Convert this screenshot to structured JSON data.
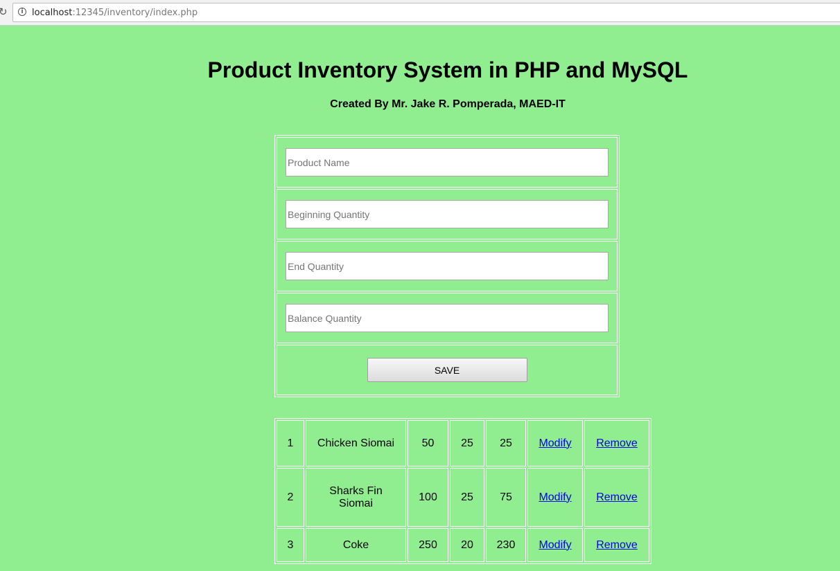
{
  "browser": {
    "url_host": "localhost",
    "url_path": ":12345/inventory/index.php"
  },
  "page": {
    "title": "Product Inventory System in PHP and MySQL",
    "subtitle": "Created By Mr. Jake R. Pomperada, MAED-IT"
  },
  "form": {
    "product_name_placeholder": "Product Name",
    "beginning_quantity_placeholder": "Beginning Quantity",
    "end_quantity_placeholder": "End Quantity",
    "balance_quantity_placeholder": "Balance Quantity",
    "save_label": "SAVE"
  },
  "products": [
    {
      "id": "1",
      "name": "Chicken Siomai",
      "beginning": "50",
      "end": "25",
      "balance": "25",
      "modify": "Modify",
      "remove": "Remove"
    },
    {
      "id": "2",
      "name": "Sharks Fin Siomai",
      "beginning": "100",
      "end": "25",
      "balance": "75",
      "modify": "Modify",
      "remove": "Remove"
    },
    {
      "id": "3",
      "name": "Coke",
      "beginning": "250",
      "end": "20",
      "balance": "230",
      "modify": "Modify",
      "remove": "Remove"
    }
  ]
}
